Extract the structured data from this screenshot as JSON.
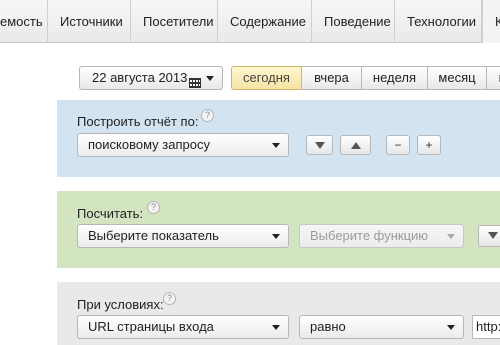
{
  "nav": {
    "tabs": [
      "емость",
      "Источники",
      "Посетители",
      "Содержание",
      "Поведение",
      "Технологии",
      "К"
    ]
  },
  "date_picker": {
    "label": "22 августа 2013",
    "calendar_icon": "calendar-icon",
    "dropdown_icon": "caret-down-icon"
  },
  "periods": [
    "сегодня",
    "вчера",
    "неделя",
    "месяц",
    "г"
  ],
  "active_period": "сегодня",
  "report": {
    "label": "Построить отчёт по:",
    "help": "?",
    "select_value": "поисковому запросу",
    "sort_desc_icon": "triangle-down-icon",
    "sort_asc_icon": "triangle-up-icon",
    "minus": "−",
    "plus": "+"
  },
  "calculate": {
    "label": "Посчитать:",
    "help": "?",
    "metric_value": "Выберите показатель",
    "function_value": "Выберите функцию"
  },
  "conditions": {
    "label": "При условиях:",
    "help": "?",
    "field_value": "URL страницы входа",
    "operator_value": "равно",
    "input_value": "http:/"
  },
  "colors": {
    "report_panel": "#d4e3f0",
    "calculate_panel": "#d3e5c0",
    "conditions_panel": "#e9e9e9",
    "active_period_bg": "#f9ecb6"
  }
}
